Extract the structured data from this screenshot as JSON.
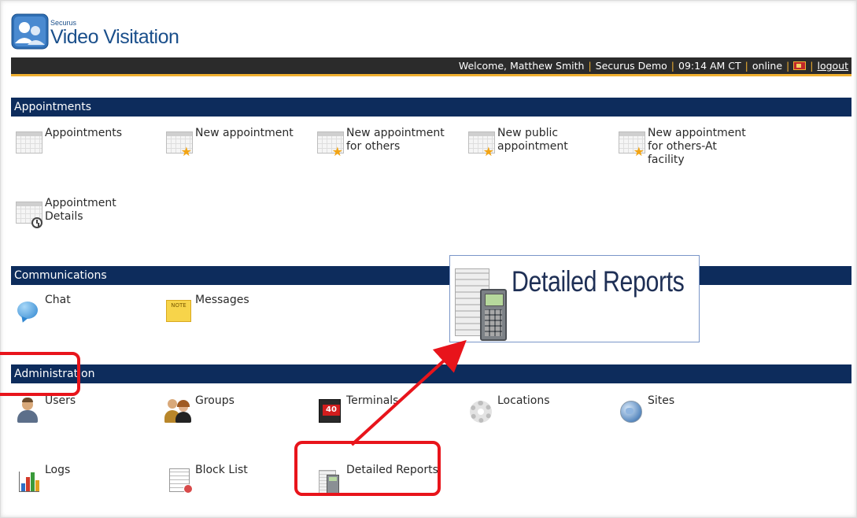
{
  "logo": {
    "small": "Securus",
    "big": "Video Visitation"
  },
  "status_bar": {
    "welcome": "Welcome, Matthew Smith",
    "facility": "Securus Demo",
    "time": "09:14 AM CT",
    "status": "online",
    "logout": "logout",
    "colors": {
      "bar": "#2b2b2b",
      "accent": "#f0b030"
    }
  },
  "sections": {
    "appointments": {
      "title": "Appointments",
      "items": [
        {
          "label": "Appointments",
          "icon": "calendar-icon"
        },
        {
          "label": "New appointment",
          "icon": "calendar-star-icon"
        },
        {
          "label": "New appointment\nfor others",
          "icon": "calendar-star-icon"
        },
        {
          "label": "New public\nappointment",
          "icon": "calendar-star-icon"
        },
        {
          "label": "New appointment\nfor others-At\nfacility",
          "icon": "calendar-star-icon"
        },
        {
          "label": "Appointment\nDetails",
          "icon": "calendar-clock-icon"
        }
      ]
    },
    "communications": {
      "title": "Communications",
      "items": [
        {
          "label": "Chat",
          "icon": "chat-bubble-icon"
        },
        {
          "label": "Messages",
          "icon": "note-icon",
          "icon_text": "NOTE"
        }
      ]
    },
    "administration": {
      "title": "Administration",
      "items": [
        {
          "label": "Users",
          "icon": "user-icon"
        },
        {
          "label": "Groups",
          "icon": "group-icon"
        },
        {
          "label": "Terminals",
          "icon": "terminal-icon",
          "icon_text": "40"
        },
        {
          "label": "Locations",
          "icon": "gear-icon"
        },
        {
          "label": "Sites",
          "icon": "globe-icon"
        },
        {
          "label": "Logs",
          "icon": "bar-chart-icon"
        },
        {
          "label": "Block List",
          "icon": "block-list-icon"
        },
        {
          "label": "Detailed Reports",
          "icon": "calculator-report-icon"
        }
      ]
    }
  },
  "callout": {
    "label": "Detailed Reports",
    "icon": "calculator-report-icon"
  },
  "colors": {
    "section_header": "#0d2c5c",
    "highlight": "#e8141b",
    "callout_border": "#7a96c8"
  }
}
